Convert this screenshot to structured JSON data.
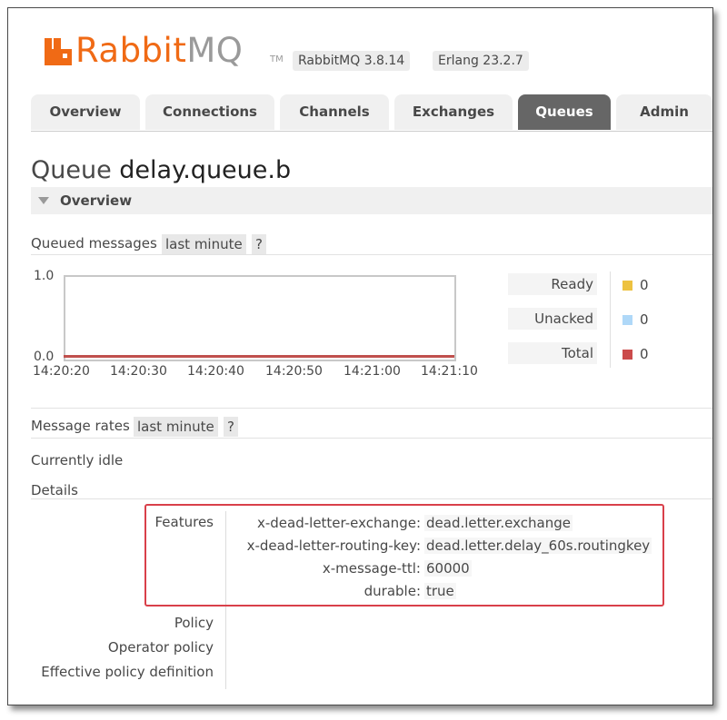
{
  "header": {
    "brand": "Rabbit",
    "brand_suffix": "MQ",
    "trademark": "TM",
    "version_rabbit": "RabbitMQ 3.8.14",
    "version_erlang": "Erlang 23.2.7",
    "brand_color": "#f06a15"
  },
  "tabs": [
    {
      "label": "Overview",
      "active": false
    },
    {
      "label": "Connections",
      "active": false
    },
    {
      "label": "Channels",
      "active": false
    },
    {
      "label": "Exchanges",
      "active": false
    },
    {
      "label": "Queues",
      "active": true
    },
    {
      "label": "Admin",
      "active": false
    }
  ],
  "page": {
    "title_prefix": "Queue",
    "queue_name": "delay.queue.b",
    "section": "Overview"
  },
  "queued_messages": {
    "label": "Queued messages",
    "range": "last minute",
    "help": "?"
  },
  "chart_data": {
    "type": "line",
    "x": [
      "14:20:20",
      "14:20:30",
      "14:20:40",
      "14:20:50",
      "14:21:00",
      "14:21:10"
    ],
    "y_ticks": [
      "1.0",
      "0.0"
    ],
    "ylim": [
      0,
      1
    ],
    "series": [
      {
        "name": "Ready",
        "values": [
          0,
          0,
          0,
          0,
          0,
          0
        ],
        "color": "#edc240"
      },
      {
        "name": "Unacked",
        "values": [
          0,
          0,
          0,
          0,
          0,
          0
        ],
        "color": "#afd8f8"
      },
      {
        "name": "Total",
        "values": [
          0,
          0,
          0,
          0,
          0,
          0
        ],
        "color": "#cb4b4b"
      }
    ]
  },
  "legend": [
    {
      "label": "Ready",
      "value": "0",
      "color": "#edc240"
    },
    {
      "label": "Unacked",
      "value": "0",
      "color": "#afd8f8"
    },
    {
      "label": "Total",
      "value": "0",
      "color": "#cb4b4b"
    }
  ],
  "message_rates": {
    "label": "Message rates",
    "range": "last minute",
    "help": "?",
    "status": "Currently idle"
  },
  "details": {
    "label": "Details",
    "features_label": "Features",
    "features": [
      {
        "key": "x-dead-letter-exchange:",
        "value": "dead.letter.exchange"
      },
      {
        "key": "x-dead-letter-routing-key:",
        "value": "dead.letter.delay_60s.routingkey"
      },
      {
        "key": "x-message-ttl:",
        "value": "60000"
      },
      {
        "key": "durable:",
        "value": "true"
      }
    ],
    "policy_label": "Policy",
    "operator_policy_label": "Operator policy",
    "effective_policy_label": "Effective policy definition"
  }
}
